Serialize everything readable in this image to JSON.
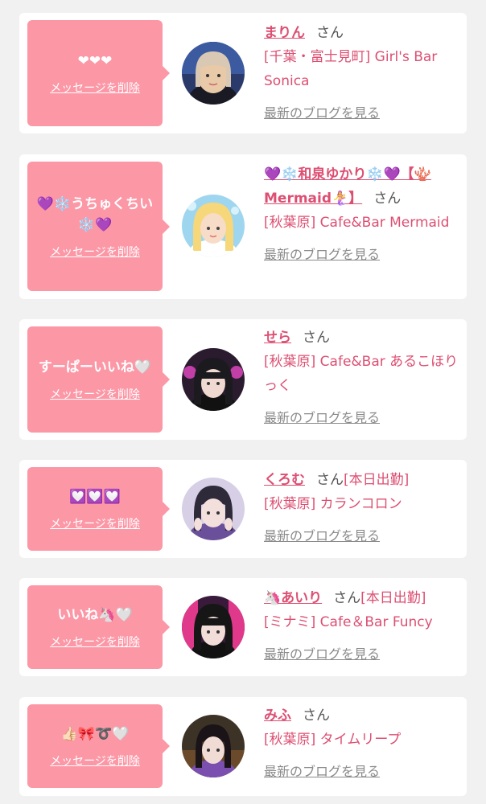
{
  "delete_label": "メッセージを削除",
  "blog_label": "最新のブログを見る",
  "suffix": "さん",
  "colors": {
    "bubble": "#fc97a6",
    "accent": "#dd4f72",
    "link_gray": "#8a8a8a",
    "background": "#f2f1f2"
  },
  "items": [
    {
      "message": "❤❤❤",
      "name": "まりん",
      "tag": "",
      "shop": "[千葉・富士見町] Girl's Bar Sonica"
    },
    {
      "message": "💜❄️うちゅくちい❄️💜",
      "name": "💜❄️和泉ゆかり❄️💜【🪸Mermaid🧜‍♀️】",
      "tag": "",
      "shop": "[秋葉原] Cafe&Bar Mermaid"
    },
    {
      "message": "すーぱーいいね🤍",
      "name": "せら",
      "tag": "",
      "shop": "[秋葉原] Cafe&Bar あるこほりっく"
    },
    {
      "message": "💟💟💟",
      "name": "くろむ",
      "tag": "[本日出勤]",
      "shop": "[秋葉原] カランコロン"
    },
    {
      "message": "いいね🦄🤍",
      "name": "🦄あいり",
      "tag": "[本日出勤]",
      "shop": "[ミナミ] Cafe＆Bar Funcy"
    },
    {
      "message": "👍🏻🎀➰🤍",
      "name": "みふ",
      "tag": "",
      "shop": "[秋葉原] タイムリープ"
    }
  ]
}
